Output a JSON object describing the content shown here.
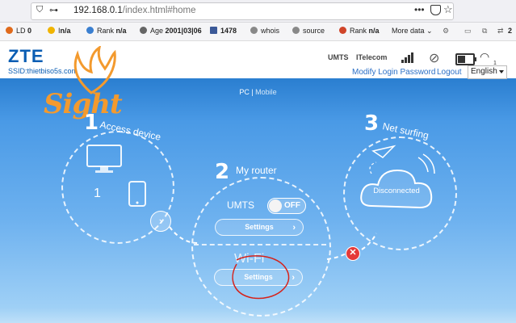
{
  "browser": {
    "url_host": "192.168.0.1",
    "url_path": "/index.html#home",
    "menu_dots": "•••"
  },
  "seo_toolbar": {
    "items": [
      {
        "label": "LD",
        "value": "0",
        "icon": "link-density-icon",
        "color": "#e06a1b"
      },
      {
        "label": "I",
        "value": "n/a",
        "icon": "index-icon",
        "color": "#f0b400"
      },
      {
        "label": "Rank",
        "value": "n/a",
        "icon": "rank-icon",
        "color": "#3a7fd0"
      },
      {
        "label": "Age",
        "value": "2001|03|06",
        "icon": "age-icon",
        "color": "#666666"
      },
      {
        "label": "",
        "value": "1478",
        "icon": "facebook-icon",
        "color": "#3b5998"
      },
      {
        "label": "whois",
        "value": "",
        "icon": "whois-icon",
        "color": "#888888"
      },
      {
        "label": "source",
        "value": "",
        "icon": "source-icon",
        "color": "#888888"
      },
      {
        "label": "Rank",
        "value": "n/a",
        "icon": "rank-icon",
        "color": "#d0452a"
      }
    ],
    "more": "More data",
    "count": "2"
  },
  "router": {
    "brand": "ZTE",
    "ssid": "SSID:thietbiso5s.com",
    "watermark": "Sight",
    "network_type": "UMTS",
    "operator": "ITelecom",
    "modify_password": "Modify Login Password",
    "logout": "Logout",
    "language": "English",
    "wifi_clients": "1",
    "mode_pc": "PC",
    "mode_sep": " | ",
    "mode_mobile": "Mobile",
    "step1": {
      "number": "1",
      "title": "Access device",
      "count": "1"
    },
    "step2": {
      "number": "2",
      "title": "My router",
      "network": "UMTS",
      "toggle": "OFF",
      "settings": "Settings",
      "wifi_label": "Wi-Fi",
      "wifi_settings": "Settings"
    },
    "step3": {
      "number": "3",
      "title": "Net surfing",
      "status": "Disconnected"
    }
  },
  "colors": {
    "brand": "#0a5db3",
    "link": "#2b6fc6",
    "error": "#e53939",
    "annotation": "#d6221a"
  }
}
